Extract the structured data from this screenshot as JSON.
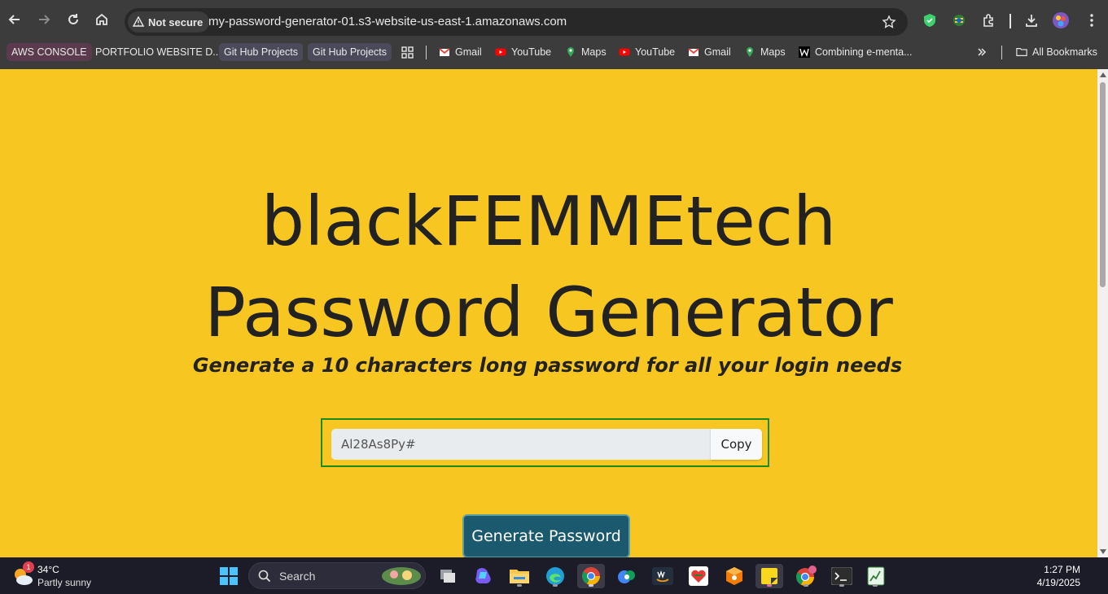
{
  "browser": {
    "security_label": "Not secure",
    "url": "my-password-generator-01.s3-website-us-east-1.amazonaws.com",
    "bookmarks": [
      {
        "label": "AWS CONSOLE"
      },
      {
        "label": "PORTFOLIO WEBSITE D..."
      },
      {
        "label": "Git Hub Projects"
      },
      {
        "label": "Git Hub Projects"
      },
      {
        "label": "Gmail"
      },
      {
        "label": "YouTube"
      },
      {
        "label": "Maps"
      },
      {
        "label": "YouTube"
      },
      {
        "label": "Gmail"
      },
      {
        "label": "Maps"
      },
      {
        "label": "Combining e-menta..."
      }
    ],
    "all_bookmarks_label": "All Bookmarks"
  },
  "page": {
    "title_line1": "blackFEMMEtech",
    "title_line2": "Password Generator",
    "subtitle": "Generate a 10 characters long password for all your login needs",
    "password_value": "Al28As8Py#",
    "copy_label": "Copy",
    "generate_label": "Generate Password",
    "background_color": "#f8c620",
    "button_color": "#1b5a6e"
  },
  "taskbar": {
    "weather_badge": "1",
    "weather_temp": "34°C",
    "weather_desc": "Partly sunny",
    "search_placeholder": "Search",
    "time": "1:27 PM",
    "date": "4/19/2025"
  }
}
